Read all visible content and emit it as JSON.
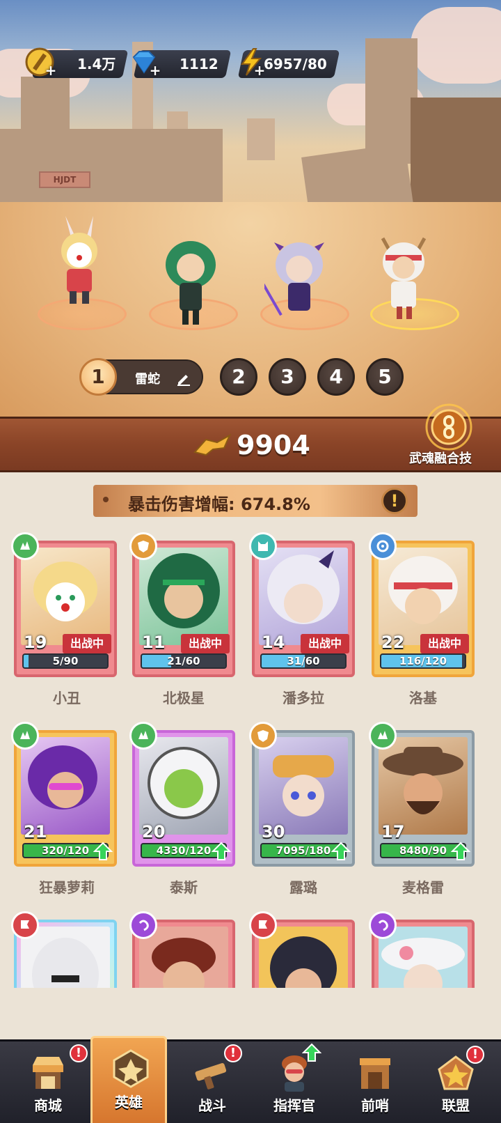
{
  "resources": {
    "gold": "1.4万",
    "diamonds": "1112",
    "energy": "6957/80"
  },
  "team": {
    "active_slot": "1",
    "active_name": "雷蛇",
    "slots": [
      "1",
      "2",
      "3",
      "4",
      "5"
    ]
  },
  "power": {
    "value": "9904",
    "fusion_label": "武魂融合技"
  },
  "bonus": {
    "text": "暴击伤害增幅: 674.8%"
  },
  "heroes": [
    {
      "name": "小丑",
      "level": "19",
      "status": "出战中",
      "progress": "5/90",
      "progress_fraction": 0.06,
      "rarity": "red",
      "faction": "green"
    },
    {
      "name": "北极星",
      "level": "11",
      "status": "出战中",
      "progress": "21/60",
      "progress_fraction": 0.35,
      "rarity": "red",
      "faction": "orange"
    },
    {
      "name": "潘多拉",
      "level": "14",
      "status": "出战中",
      "progress": "31/60",
      "progress_fraction": 0.52,
      "rarity": "red",
      "faction": "teal"
    },
    {
      "name": "洛基",
      "level": "22",
      "status": "出战中",
      "progress": "116/120",
      "progress_fraction": 0.97,
      "rarity": "gold",
      "faction": "blue"
    },
    {
      "name": "狂暴萝莉",
      "level": "21",
      "status": "",
      "progress": "320/120",
      "progress_fraction": 1.0,
      "rarity": "gold",
      "faction": "green"
    },
    {
      "name": "泰斯",
      "level": "20",
      "status": "",
      "progress": "4330/120",
      "progress_fraction": 1.0,
      "rarity": "purple",
      "faction": "green"
    },
    {
      "name": "露璐",
      "level": "30",
      "status": "",
      "progress": "7095/180",
      "progress_fraction": 1.0,
      "rarity": "gray",
      "faction": "orange"
    },
    {
      "name": "麦格雷",
      "level": "17",
      "status": "",
      "progress": "8480/90",
      "progress_fraction": 1.0,
      "rarity": "gray",
      "faction": "green"
    }
  ],
  "nav": [
    {
      "label": "商城",
      "alert": "!"
    },
    {
      "label": "英雄",
      "alert": ""
    },
    {
      "label": "战斗",
      "alert": "!"
    },
    {
      "label": "指挥官",
      "alert": ""
    },
    {
      "label": "前哨",
      "alert": ""
    },
    {
      "label": "联盟",
      "alert": "!"
    }
  ],
  "scene": {
    "shop_sign": "HJDT"
  },
  "colors": {
    "accent": "#f2b067",
    "deploy_badge": "#c9333b",
    "bar_blue": "#5fc3ec",
    "bar_green": "#37b64a"
  }
}
